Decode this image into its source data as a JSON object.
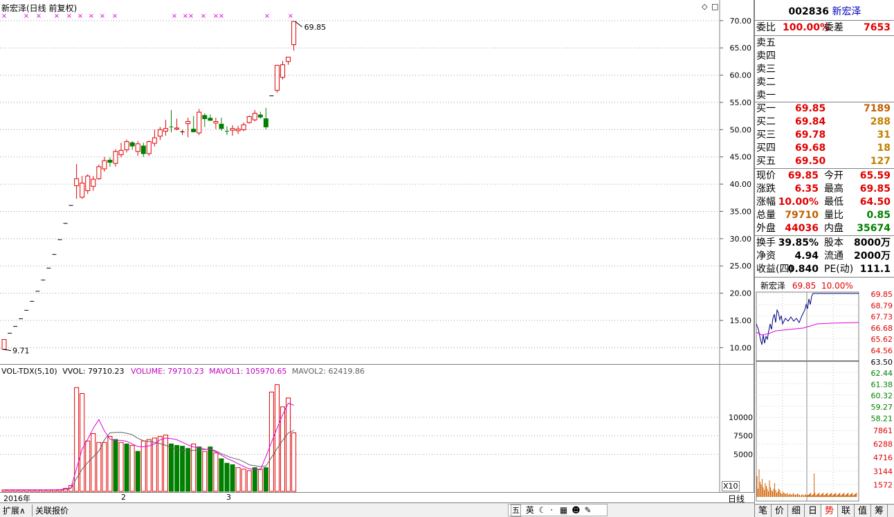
{
  "chart_title": "新宏泽(日线 前复权)",
  "vol_header": [
    "VOL-TDX(5,10)",
    "VVOL: 79710.23",
    "VOLUME: 79710.23",
    "MAVOL1: 105970.65",
    "MAVOL2: 62419.86"
  ],
  "price_high_label": "69.85",
  "price_low_label": "9.71",
  "date_labels": [
    "2016年",
    "2",
    "3"
  ],
  "x10_label": "X10",
  "period_label": "日线",
  "bottom_tabs": [
    "扩展∧",
    "关联报价"
  ],
  "ime": {
    "cn": "五",
    "lang": "英"
  },
  "quote": {
    "code": "002836",
    "name": "新宏泽",
    "weibi_label": "委比",
    "weibi": "100.00%",
    "weicha_label": "委差",
    "weicha": "7653",
    "sells": [
      "卖五",
      "卖四",
      "卖三",
      "卖二",
      "卖一"
    ],
    "buys": [
      {
        "label": "买一",
        "price": "69.85",
        "vol": "7189"
      },
      {
        "label": "买二",
        "price": "69.84",
        "vol": "288"
      },
      {
        "label": "买三",
        "price": "69.78",
        "vol": "31"
      },
      {
        "label": "买四",
        "price": "69.68",
        "vol": "18"
      },
      {
        "label": "买五",
        "price": "69.50",
        "vol": "127"
      }
    ],
    "stats": [
      {
        "l1": "现价",
        "v1": "69.85",
        "l2": "今开",
        "v2": "65.59"
      },
      {
        "l1": "涨跌",
        "v1": "6.35",
        "l2": "最高",
        "v2": "69.85"
      },
      {
        "l1": "涨幅",
        "v1": "10.00%",
        "l2": "最低",
        "v2": "64.50"
      },
      {
        "l1": "总量",
        "v1": "79710",
        "l2": "量比",
        "v2": "0.85"
      },
      {
        "l1": "外盘",
        "v1": "44036",
        "l2": "内盘",
        "v2": "35674"
      }
    ],
    "stats2": [
      {
        "l1": "换手",
        "v1": "39.85%",
        "l2": "股本",
        "v2": "8000万"
      },
      {
        "l1": "净资",
        "v1": "4.94",
        "l2": "流通",
        "v2": "2000万"
      },
      {
        "l1": "收益(四)",
        "v1": "0.840",
        "l2": "PE(动)",
        "v2": "111.1"
      }
    ]
  },
  "intraday": {
    "header_name": "新宏泽",
    "header_price": "69.85",
    "header_pct": "10.00%",
    "price_ticks_red": [
      "69.85",
      "68.79",
      "67.73",
      "66.68",
      "65.62",
      "64.56"
    ],
    "price_mid": "63.50",
    "price_ticks_green": [
      "62.44",
      "61.38",
      "60.32",
      "59.27",
      "58.21"
    ],
    "vol_ticks": [
      "7861",
      "6288",
      "4716",
      "3144",
      "1572"
    ],
    "tabs": [
      "笔",
      "价",
      "细",
      "日",
      "势",
      "联",
      "值",
      "筹"
    ],
    "active_tab": "势"
  },
  "chart_data": [
    {
      "type": "candlestick",
      "title": "新宏泽(日线 前复权)",
      "y_ticks": [
        10,
        15,
        20,
        25,
        30,
        35,
        40,
        45,
        50,
        55,
        60,
        65,
        70
      ],
      "ylim": [
        7.5,
        71.5
      ],
      "candles": [
        [
          9.71,
          11.5,
          9.71,
          11.5
        ],
        [
          12.65,
          12.65,
          12.65,
          12.65
        ],
        [
          13.9,
          13.9,
          13.9,
          13.9
        ],
        [
          15.3,
          15.3,
          15.3,
          15.3
        ],
        [
          16.85,
          16.85,
          16.85,
          16.85
        ],
        [
          18.5,
          18.5,
          18.5,
          18.5
        ],
        [
          20.35,
          20.35,
          20.35,
          20.35
        ],
        [
          22.4,
          22.4,
          22.4,
          22.4
        ],
        [
          24.6,
          24.6,
          24.6,
          24.6
        ],
        [
          27.1,
          27.1,
          27.1,
          27.1
        ],
        [
          29.8,
          29.8,
          29.8,
          29.8
        ],
        [
          32.8,
          32.8,
          32.8,
          32.8
        ],
        [
          36.1,
          36.1,
          36.1,
          36.1
        ],
        [
          39.71,
          43.7,
          37.3,
          41.0
        ],
        [
          37.6,
          41.5,
          37.3,
          40.2
        ],
        [
          38.8,
          41.8,
          38.2,
          41.5
        ],
        [
          39.6,
          41.5,
          38.8,
          40.9
        ],
        [
          41.0,
          43.6,
          40.8,
          43.2
        ],
        [
          42.8,
          45.0,
          42.3,
          44.3
        ],
        [
          44.4,
          44.9,
          43.2,
          44.0
        ],
        [
          43.8,
          46.4,
          43.2,
          46.0
        ],
        [
          45.4,
          47.6,
          44.9,
          46.2
        ],
        [
          46.3,
          48.2,
          45.8,
          47.8
        ],
        [
          47.6,
          47.9,
          46.3,
          47.0
        ],
        [
          46.0,
          47.9,
          45.2,
          47.4
        ],
        [
          47.0,
          47.6,
          45.0,
          45.6
        ],
        [
          45.6,
          48.0,
          45.2,
          47.8
        ],
        [
          47.5,
          50.0,
          46.9,
          48.5
        ],
        [
          48.8,
          50.5,
          48.1,
          50.0
        ],
        [
          49.7,
          51.8,
          48.9,
          50.2
        ],
        [
          50.5,
          53.6,
          49.5,
          50.4
        ],
        [
          50.1,
          52.0,
          49.9,
          50.3
        ],
        [
          49.6,
          50.0,
          49.0,
          49.6
        ],
        [
          51.1,
          52.2,
          48.6,
          51.5
        ],
        [
          50.1,
          52.5,
          49.5,
          49.6
        ],
        [
          49.4,
          53.8,
          49.0,
          53.2
        ],
        [
          52.6,
          53.0,
          50.5,
          52.0
        ],
        [
          52.1,
          52.8,
          51.6,
          51.7
        ],
        [
          51.2,
          52.2,
          50.1,
          51.5
        ],
        [
          51.0,
          52.2,
          49.8,
          50.2
        ],
        [
          49.7,
          50.6,
          49.0,
          49.6
        ],
        [
          49.9,
          50.8,
          48.9,
          50.2
        ],
        [
          49.8,
          50.7,
          49.2,
          50.1
        ],
        [
          50.0,
          51.3,
          49.7,
          50.9
        ],
        [
          51.3,
          52.6,
          51.1,
          52.4
        ],
        [
          51.8,
          53.6,
          51.5,
          53.0
        ],
        [
          52.7,
          53.3,
          52.0,
          52.3
        ],
        [
          52.0,
          54.0,
          50.0,
          50.5
        ],
        [
          56.2,
          56.2,
          56.2,
          56.2
        ],
        [
          57.2,
          61.9,
          56.8,
          61.8
        ],
        [
          59.6,
          62.6,
          59.2,
          61.9
        ],
        [
          62.5,
          63.3,
          61.9,
          63.3
        ],
        [
          65.59,
          69.85,
          64.5,
          69.85
        ]
      ]
    },
    {
      "type": "bar",
      "title": "VOL-TDX(5,10)",
      "y_ticks": [
        5000,
        7500,
        10000
      ],
      "ylim": [
        0,
        15400
      ],
      "values": [
        200,
        200,
        200,
        200,
        200,
        200,
        200,
        200,
        200,
        200,
        200,
        400,
        800,
        14000,
        13200,
        6800,
        7800,
        6600,
        6600,
        7400,
        7000,
        6600,
        6400,
        6200,
        5400,
        6800,
        7000,
        7200,
        7400,
        7600,
        6400,
        6200,
        6100,
        5800,
        6400,
        6000,
        5400,
        6000,
        5200,
        4400,
        3800,
        3600,
        3200,
        3000,
        2800,
        3200,
        3000,
        3200,
        13400,
        14400,
        11400,
        12600,
        7900
      ],
      "down": [
        0,
        0,
        0,
        0,
        0,
        0,
        0,
        0,
        0,
        0,
        0,
        0,
        0,
        0,
        0,
        0,
        0,
        0,
        0,
        0,
        1,
        0,
        1,
        0,
        1,
        0,
        0,
        0,
        0,
        0,
        1,
        1,
        1,
        1,
        0,
        1,
        0,
        1,
        0,
        1,
        1,
        1,
        0,
        0,
        0,
        1,
        0,
        1,
        0,
        0,
        0,
        0,
        0
      ],
      "mavol1": [
        200,
        200,
        200,
        200,
        200,
        200,
        200,
        200,
        200,
        200,
        240,
        320,
        480,
        3120,
        5720,
        7040,
        8520,
        9680,
        8160,
        7040,
        6880,
        6880,
        6760,
        6400,
        6040,
        6020,
        6120,
        6400,
        6960,
        7200,
        7120,
        6960,
        6620,
        6260,
        5980,
        5900,
        5700,
        5660,
        5340,
        4880,
        4440,
        4120,
        3720,
        3360,
        3040,
        2980,
        2920,
        4720,
        6640,
        8540,
        10320,
        11900,
        11620
      ],
      "mavol2": [
        200,
        200,
        200,
        200,
        200,
        200,
        200,
        200,
        200,
        200,
        200,
        280,
        400,
        1760,
        3000,
        3900,
        4660,
        5420,
        6960,
        7900,
        7960,
        7960,
        7840,
        7640,
        7160,
        6840,
        6740,
        6600,
        6440,
        6220,
        5900,
        5700,
        5540,
        5460,
        5540,
        5560,
        5660,
        5680,
        5450,
        5080,
        4780,
        4500,
        4320,
        4000,
        3580,
        3460,
        3340,
        3420,
        4600,
        5790,
        6880,
        7880,
        8230
      ]
    }
  ]
}
